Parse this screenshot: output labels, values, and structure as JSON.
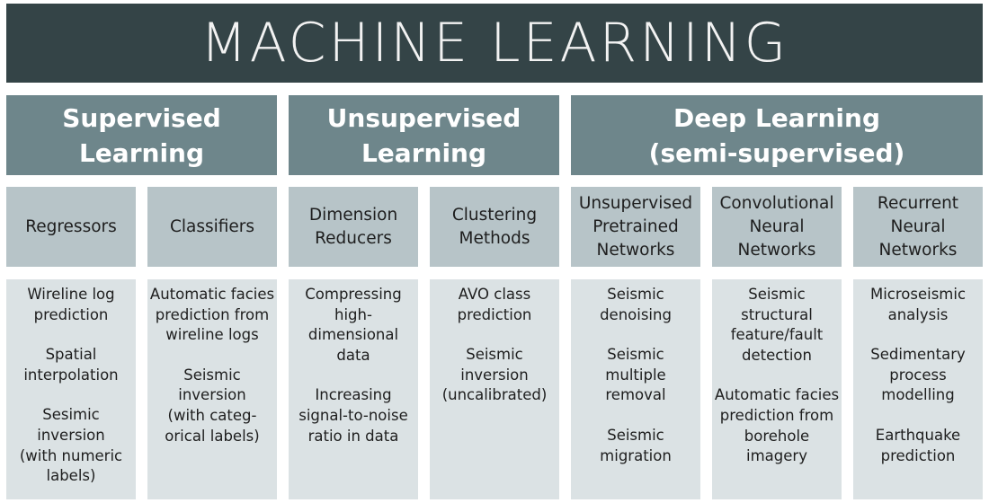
{
  "title": "MACHINE LEARNING",
  "colors": {
    "title_bg": "#344447",
    "category_bg": "#6e868b",
    "subcategory_bg": "#b7c4c8",
    "content_bg": "#dbe2e4"
  },
  "categories": [
    {
      "label": "Supervised\nLearning",
      "subcategories": [
        {
          "label": "Regressors",
          "items": [
            "Wireline log\nprediction",
            "Spatial\ninterpolation",
            "Sesimic\ninversion\n(with numeric\nlabels)"
          ]
        },
        {
          "label": "Classifiers",
          "items": [
            "Automatic facies\nprediction from\nwireline logs",
            "Seismic\ninversion\n(with categ-\norical labels)"
          ]
        }
      ]
    },
    {
      "label": "Unsupervised\nLearning",
      "subcategories": [
        {
          "label": "Dimension\nReducers",
          "items": [
            "Compressing\nhigh-\ndimensional\ndata",
            "Increasing\nsignal-to-noise\nratio in data"
          ]
        },
        {
          "label": "Clustering\nMethods",
          "items": [
            "AVO class\nprediction",
            "Seismic\ninversion\n(uncalibrated)"
          ]
        }
      ]
    },
    {
      "label": "Deep Learning\n(semi-supervised)",
      "subcategories": [
        {
          "label": "Unsupervised\nPretrained\nNetworks",
          "items": [
            "Seismic\ndenoising",
            "Seismic\nmultiple\nremoval",
            "Seismic\nmigration"
          ]
        },
        {
          "label": "Convolutional\nNeural\nNetworks",
          "items": [
            "Seismic\nstructural\nfeature/fault\ndetection",
            "Automatic facies\nprediction from\nborehole\nimagery"
          ]
        },
        {
          "label": "Recurrent\nNeural\nNetworks",
          "items": [
            "Microseismic\nanalysis",
            "Sedimentary\nprocess\nmodelling",
            "Earthquake\nprediction"
          ]
        }
      ]
    }
  ]
}
